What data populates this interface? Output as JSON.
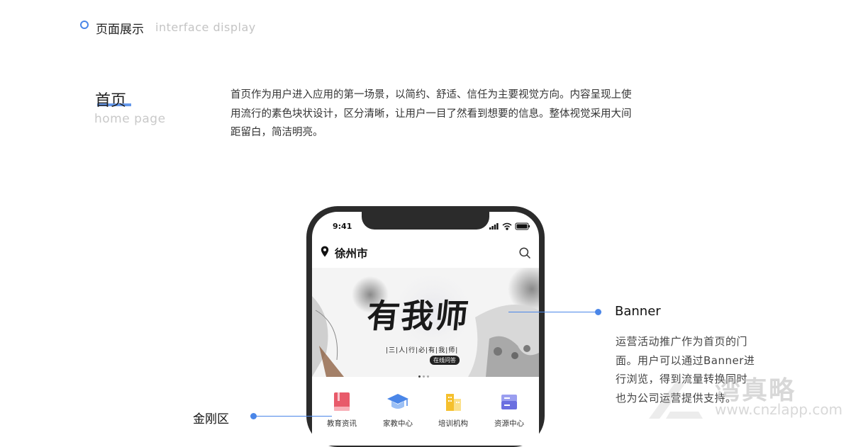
{
  "header": {
    "title": "页面展示",
    "subtitle": "interface display"
  },
  "section": {
    "title": "首页",
    "subtitle": "home page",
    "description_lines": [
      "首页作为用户进入应用的第一场景，以简约、舒适、信任为主要视觉方向。内容呈现上使",
      "用流行的素色块状设计，区分清晰，让用户一目了然看到想要的信息。整体视觉采用大间",
      "距留白，简洁明亮。"
    ]
  },
  "phone": {
    "status_time": "9:41",
    "city": "徐州市",
    "banner": {
      "title": "有我师",
      "tagline": "|三|人|行|必|有|我|师|",
      "online_label": "在线问答"
    },
    "kingkong": [
      {
        "label": "教育资讯",
        "icon": "book-icon",
        "color": "#e85a6a"
      },
      {
        "label": "家教中心",
        "icon": "graduation-cap-icon",
        "color": "#4a86e8"
      },
      {
        "label": "培训机构",
        "icon": "building-icon",
        "color": "#f5c02e"
      },
      {
        "label": "资源中心",
        "icon": "folder-icon",
        "color": "#6b6fe0"
      }
    ]
  },
  "callouts": {
    "banner_label": "Banner",
    "banner_desc_lines": [
      "运营活动推广作为首页的门",
      "面。用户可以通过Banner进",
      "行浏览，得到流量转换同时",
      "也为公司运营提供支持。"
    ],
    "kingkong_label": "金刚区"
  },
  "watermark": {
    "text": "湾真略",
    "url": "www.cnzlapp.com"
  },
  "colors": {
    "accent": "#4a86e8",
    "phone_frame": "#2b2b2b"
  }
}
